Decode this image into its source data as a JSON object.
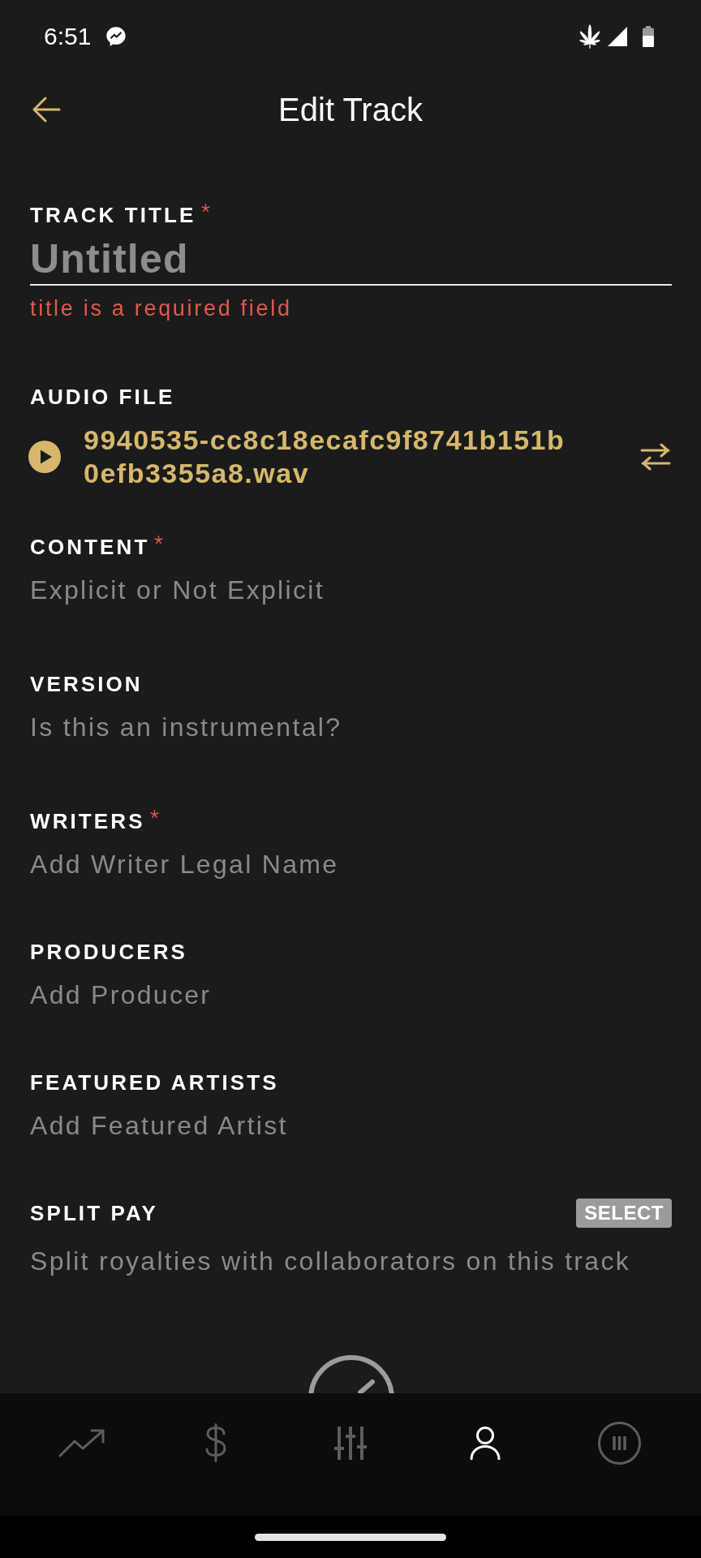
{
  "status_bar": {
    "time": "6:51"
  },
  "header": {
    "title": "Edit Track"
  },
  "form": {
    "fields": [
      {
        "kind": "text_input",
        "label": "TRACK TITLE",
        "required": true,
        "placeholder": "Untitled",
        "error": "title is a required field"
      },
      {
        "kind": "audio_file",
        "label": "AUDIO FILE",
        "required": false,
        "file_name": "9940535-cc8c18ecafc9f8741b151b0efb3355a8.wav"
      },
      {
        "kind": "select",
        "label": "CONTENT",
        "required": true,
        "placeholder": "Explicit or Not Explicit"
      },
      {
        "kind": "select",
        "label": "VERSION",
        "required": false,
        "placeholder": "Is this an instrumental?"
      },
      {
        "kind": "input",
        "label": "WRITERS",
        "required": true,
        "placeholder": "Add Writer Legal Name"
      },
      {
        "kind": "input",
        "label": "PRODUCERS",
        "required": false,
        "placeholder": "Add Producer"
      },
      {
        "kind": "input",
        "label": "FEATURED ARTISTS",
        "required": false,
        "placeholder": "Add Featured Artist"
      },
      {
        "kind": "action",
        "label": "SPLIT PAY",
        "required": false,
        "button": "SELECT",
        "description": "Split royalties with collaborators on this track"
      }
    ]
  },
  "bottom_nav": {
    "items": [
      {
        "kind": "trend",
        "selected": false
      },
      {
        "kind": "dollar",
        "selected": false
      },
      {
        "kind": "sliders",
        "selected": false
      },
      {
        "kind": "profile",
        "selected": true
      },
      {
        "kind": "bars",
        "selected": false
      }
    ]
  }
}
